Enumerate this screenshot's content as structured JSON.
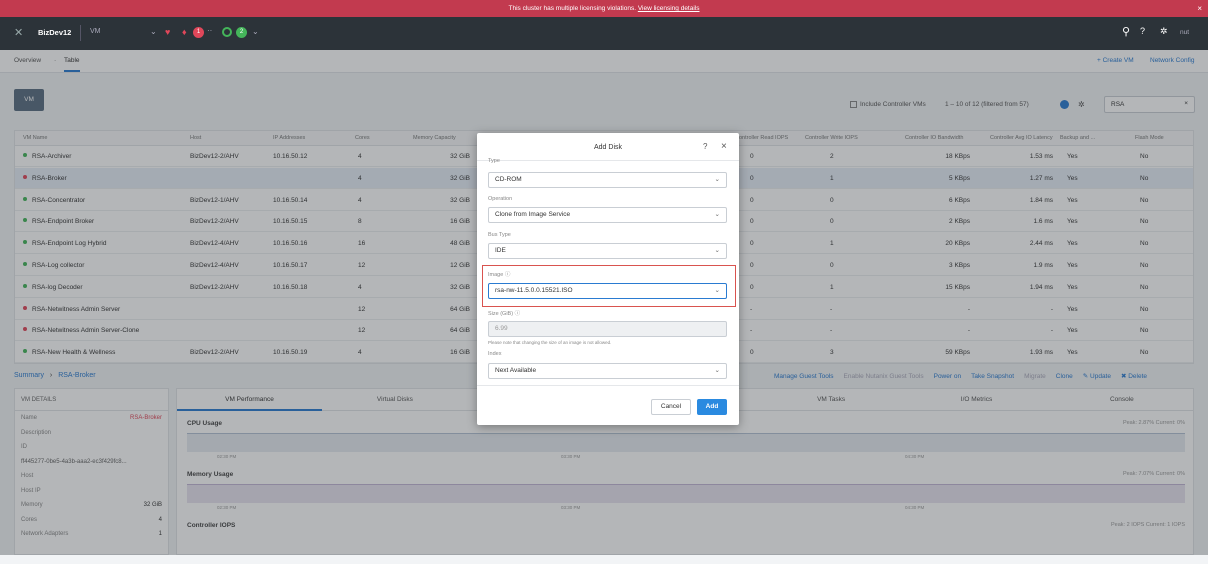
{
  "banner": {
    "text": "This cluster has multiple licensing violations.",
    "link": "View licensing details",
    "close": "×"
  },
  "topbar": {
    "cluster": "BizDev12",
    "section": "VM",
    "health_icon": "heart-icon",
    "alert_count": "1",
    "task_count": "2",
    "user": "nut"
  },
  "subnav": {
    "overview": "Overview",
    "sep": "·",
    "table": "Table",
    "create_vm": "+ Create VM",
    "network_config": "Network Config"
  },
  "toolbar": {
    "vm_button": "VM",
    "include_controller": "Include Controller VMs",
    "pagination": "1 – 10 of 12 (filtered from 57)",
    "search_value": "RSA",
    "clear": "×"
  },
  "table": {
    "headers": [
      "VM Name",
      "Host",
      "IP Addresses",
      "Cores",
      "Memory Capacity",
      "Controller Read IOPS",
      "Controller Write IOPS",
      "Controller IO Bandwidth",
      "Controller Avg IO Latency",
      "Backup and ...",
      "Flash Mode"
    ],
    "rows": [
      {
        "name": "RSA-Archiver",
        "host": "BizDev12-2/AHV",
        "ip": "10.16.50.12",
        "cores": "4",
        "mem": "32 GiB",
        "read": "0",
        "write": "2",
        "bw": "18 KBps",
        "lat": "1.53 ms",
        "backup": "Yes",
        "flash": "No",
        "status": "on"
      },
      {
        "name": "RSA-Broker",
        "host": "",
        "ip": "",
        "cores": "4",
        "mem": "32 GiB",
        "read": "0",
        "write": "1",
        "bw": "5 KBps",
        "lat": "1.27 ms",
        "backup": "Yes",
        "flash": "No",
        "status": "off"
      },
      {
        "name": "RSA-Concentrator",
        "host": "BizDev12-1/AHV",
        "ip": "10.16.50.14",
        "cores": "4",
        "mem": "32 GiB",
        "read": "0",
        "write": "0",
        "bw": "6 KBps",
        "lat": "1.84 ms",
        "backup": "Yes",
        "flash": "No",
        "status": "on"
      },
      {
        "name": "RSA-Endpoint Broker",
        "host": "BizDev12-2/AHV",
        "ip": "10.16.50.15",
        "cores": "8",
        "mem": "16 GiB",
        "read": "0",
        "write": "0",
        "bw": "2 KBps",
        "lat": "1.6 ms",
        "backup": "Yes",
        "flash": "No",
        "status": "on"
      },
      {
        "name": "RSA-Endpoint Log Hybrid",
        "host": "BizDev12-4/AHV",
        "ip": "10.16.50.16",
        "cores": "16",
        "mem": "48 GiB",
        "read": "0",
        "write": "1",
        "bw": "20 KBps",
        "lat": "2.44 ms",
        "backup": "Yes",
        "flash": "No",
        "status": "on"
      },
      {
        "name": "RSA-Log collector",
        "host": "BizDev12-4/AHV",
        "ip": "10.16.50.17",
        "cores": "12",
        "mem": "12 GiB",
        "read": "0",
        "write": "0",
        "bw": "3 KBps",
        "lat": "1.9 ms",
        "backup": "Yes",
        "flash": "No",
        "status": "on"
      },
      {
        "name": "RSA-log Decoder",
        "host": "BizDev12-2/AHV",
        "ip": "10.16.50.18",
        "cores": "4",
        "mem": "32 GiB",
        "read": "0",
        "write": "1",
        "bw": "15 KBps",
        "lat": "1.94 ms",
        "backup": "Yes",
        "flash": "No",
        "status": "on"
      },
      {
        "name": "RSA-Netwitness Admin Server",
        "host": "",
        "ip": "",
        "cores": "12",
        "mem": "64 GiB",
        "read": "-",
        "write": "-",
        "bw": "-",
        "lat": "-",
        "backup": "Yes",
        "flash": "No",
        "status": "off"
      },
      {
        "name": "RSA-Netwitness Admin Server-Clone",
        "host": "",
        "ip": "",
        "cores": "12",
        "mem": "64 GiB",
        "read": "-",
        "write": "-",
        "bw": "-",
        "lat": "-",
        "backup": "Yes",
        "flash": "No",
        "status": "off"
      },
      {
        "name": "RSA-New Health & Wellness",
        "host": "BizDev12-2/AHV",
        "ip": "10.16.50.19",
        "cores": "4",
        "mem": "16 GiB",
        "read": "0",
        "write": "3",
        "bw": "59 KBps",
        "lat": "1.93 ms",
        "backup": "Yes",
        "flash": "No",
        "status": "on"
      }
    ]
  },
  "summary": {
    "crumb": "Summary",
    "arrow": "›",
    "vm": "RSA-Broker",
    "actions": [
      "Manage Guest Tools",
      "Enable Nutanix Guest Tools",
      "Power on",
      "Take Snapshot",
      "Migrate",
      "Clone",
      "✎ Update",
      "✖ Delete"
    ]
  },
  "details": {
    "title": "VM DETAILS",
    "fields": [
      {
        "k": "Name",
        "v": "RSA-Broker"
      },
      {
        "k": "Description",
        "v": ""
      },
      {
        "k": "ID",
        "v": ""
      },
      {
        "k": "",
        "v": "ff445277-0be5-4a3b-aaa2-ec3f429fc8..."
      },
      {
        "k": "Host",
        "v": ""
      },
      {
        "k": "Host IP",
        "v": ""
      },
      {
        "k": "Memory",
        "v": "32 GiB"
      },
      {
        "k": "Cores",
        "v": "4"
      },
      {
        "k": "Network Adapters",
        "v": "1"
      }
    ]
  },
  "perf_tabs": [
    "VM Performance",
    "Virtual Disks",
    "VM NICs",
    "VM Snapshots",
    "VM Tasks",
    "I/O Metrics",
    "Console"
  ],
  "charts": [
    {
      "title": "CPU Usage",
      "stat": "Peak: 2.87%  Current: 0%",
      "t1": "02:30 PM",
      "t2": "03:30 PM",
      "t3": "04:30 PM"
    },
    {
      "title": "Memory Usage",
      "stat": "Peak: 7.07%  Current: 0%",
      "t1": "02:30 PM",
      "t2": "03:30 PM",
      "t3": "04:30 PM"
    },
    {
      "title": "Controller IOPS",
      "stat": "Peak: 2 IOPS  Current: 1 IOPS"
    }
  ],
  "dialog": {
    "title": "Add Disk",
    "help": "?",
    "close": "×",
    "type_label": "Type",
    "type_value": "CD-ROM",
    "op_label": "Operation",
    "op_value": "Clone from Image Service",
    "bus_label": "Bus Type",
    "bus_value": "IDE",
    "image_label": "Image",
    "image_value": "rsa-nw-11.5.0.0.15521.ISO",
    "size_label": "Size (GiB)",
    "size_value": "6.99",
    "size_note": "Please note that changing the size of an image is not allowed.",
    "index_label": "Index",
    "index_value": "Next Available",
    "cancel": "Cancel",
    "add": "Add"
  }
}
